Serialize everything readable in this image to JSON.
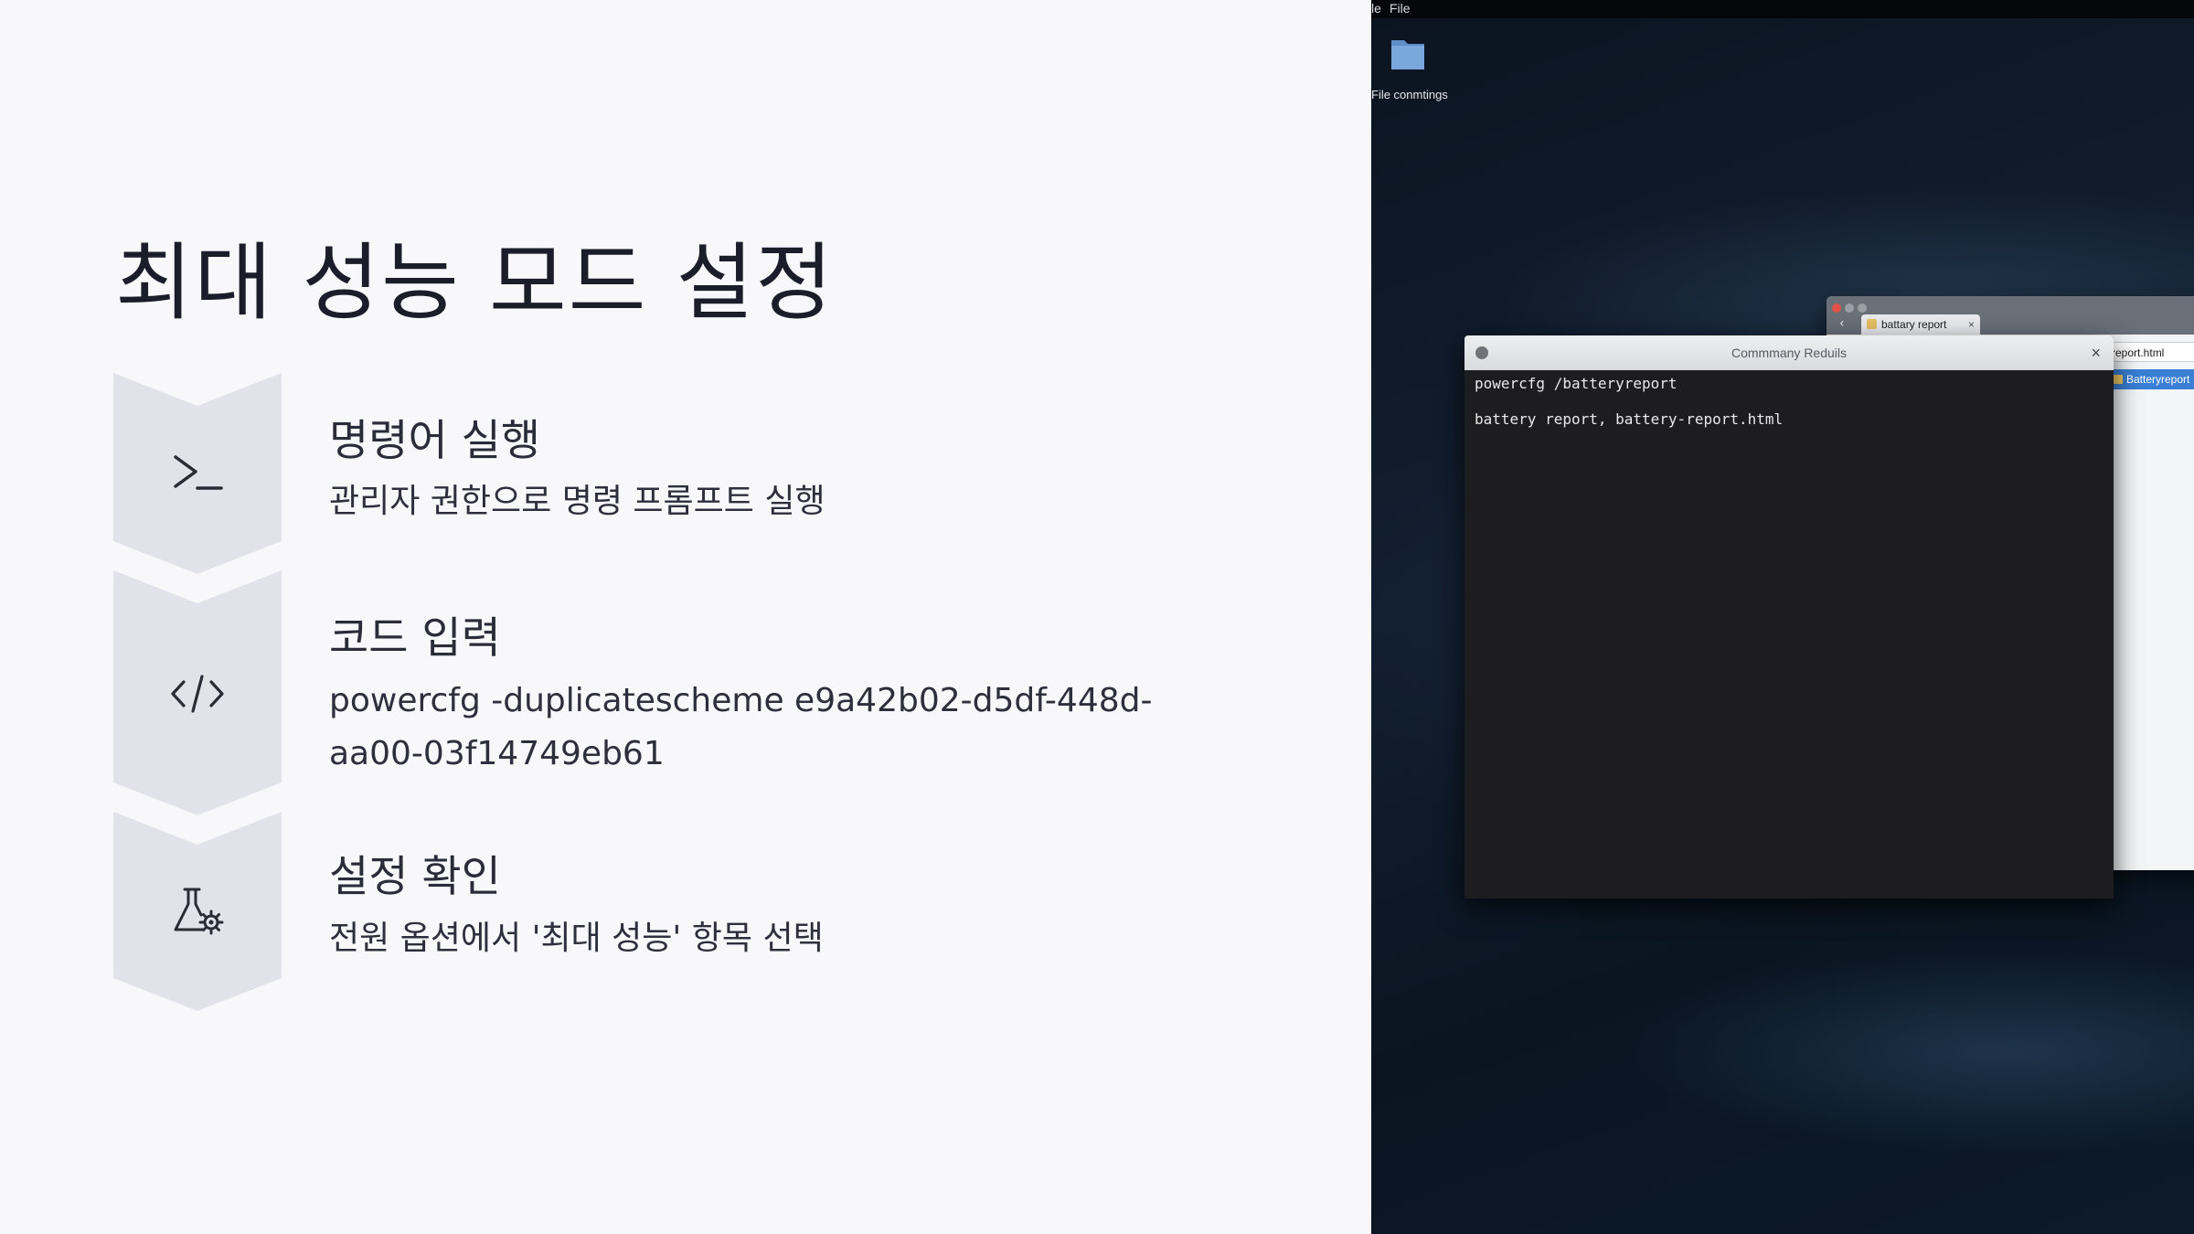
{
  "slide": {
    "title": "최대 성능 모드 설정",
    "steps": [
      {
        "icon": "terminal-prompt-icon",
        "heading": "명령어 실행",
        "description": "관리자 권한으로 명령 프롬프트 실행"
      },
      {
        "icon": "code-brackets-icon",
        "heading": "코드 입력",
        "description": "powercfg -duplicatescheme e9a42b02-d5df-448d-aa00-03f14749eb61"
      },
      {
        "icon": "flask-gear-icon",
        "heading": "설정 확인",
        "description": "전원 옵션에서 '최대 성능' 항목 선택"
      }
    ],
    "colors": {
      "background": "#f8f8fb",
      "chevron": "#e2e2ea",
      "text": "#1f2030"
    }
  },
  "desktop": {
    "menubar": {
      "items": [
        "le",
        "File"
      ]
    },
    "icon": {
      "name": "folder-icon",
      "label": "File conmtings"
    },
    "explorer": {
      "tab_label": "battary report",
      "address": "report.html",
      "selected_item": "Batteryreport"
    },
    "terminal": {
      "title": "Commmany Reduils",
      "lines": [
        "powercfg /batteryreport",
        "battery report, battery-report.html"
      ]
    }
  }
}
